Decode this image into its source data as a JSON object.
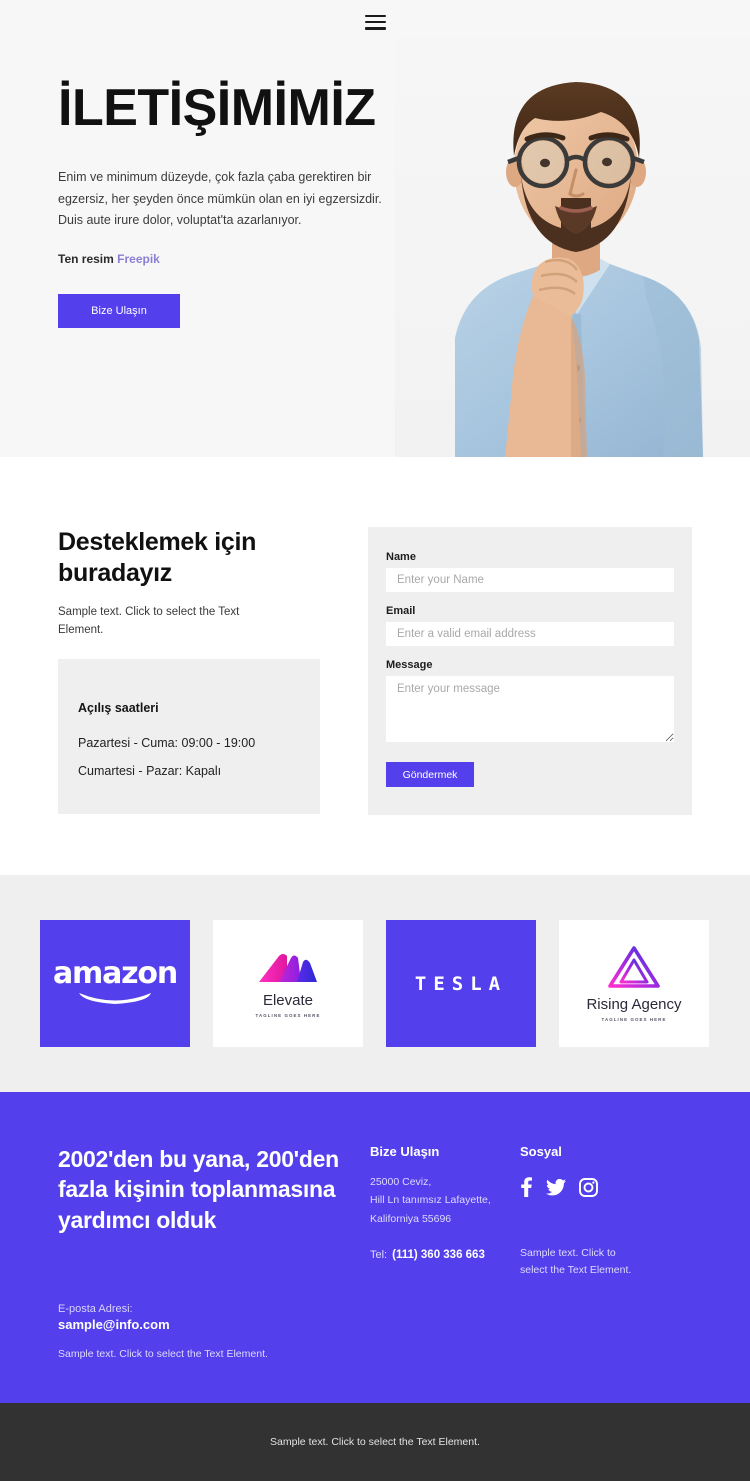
{
  "nav": {
    "menu_icon": "hamburger-menu-icon"
  },
  "hero": {
    "title": "İLETİŞİMİMİZ",
    "description": "Enim ve minimum düzeyde, çok fazla çaba gerektiren bir egzersiz, her şeyden önce mümkün olan en iyi egzersizdir. Duis aute irure dolor, voluptat'ta azarlanıyor.",
    "credit_prefix": "Ten resim",
    "credit_link": "Freepik",
    "cta_label": "Bize Ulaşın",
    "image_alt": "bearded-man-with-glasses-thinking"
  },
  "contact": {
    "heading": "Desteklemek için buradayız",
    "subtext": "Sample text. Click to select the Text Element.",
    "hours": {
      "title": "Açılış saatleri",
      "lines": [
        "Pazartesi - Cuma: 09:00 - 19:00",
        "Cumartesi - Pazar: Kapalı"
      ]
    },
    "form": {
      "name_label": "Name",
      "name_placeholder": "Enter your Name",
      "email_label": "Email",
      "email_placeholder": "Enter a valid email address",
      "message_label": "Message",
      "message_placeholder": "Enter your message",
      "submit_label": "Göndermek"
    }
  },
  "logos": [
    {
      "name": "amazon",
      "style": "purple",
      "word": "amazon"
    },
    {
      "name": "Elevate",
      "style": "white",
      "tagline": "TAGLINE GOES HERE"
    },
    {
      "name": "TESLA",
      "style": "purple",
      "word": "TESLA"
    },
    {
      "name": "Rising Agency",
      "style": "white",
      "tagline": "TAGLINE GOES HERE"
    }
  ],
  "footer": {
    "headline": "2002'den bu yana, 200'den fazla kişinin toplanmasına yardımcı olduk",
    "email_label": "E-posta Adresi:",
    "email": "sample@info.com",
    "note": "Sample text. Click to select the Text Element.",
    "contact_title": "Bize Ulaşın",
    "address_lines": [
      "25000 Ceviz,",
      "Hill Ln tanımsız Lafayette,",
      "Kaliforniya 55696"
    ],
    "tel_label": "Tel:",
    "tel_value": "(111) 360 336 663",
    "social_title": "Sosyal",
    "social_icons": [
      "facebook-icon",
      "twitter-icon",
      "instagram-icon"
    ],
    "social_note": "Sample text. Click to select the Text Element."
  },
  "bottom": {
    "text": "Sample text. Click to select the Text Element."
  },
  "colors": {
    "accent": "#5340ec",
    "hero_bg": "#f7f7f7",
    "panel_bg": "#efefef",
    "dark_bar": "#323232",
    "link": "#8b7fd4"
  }
}
